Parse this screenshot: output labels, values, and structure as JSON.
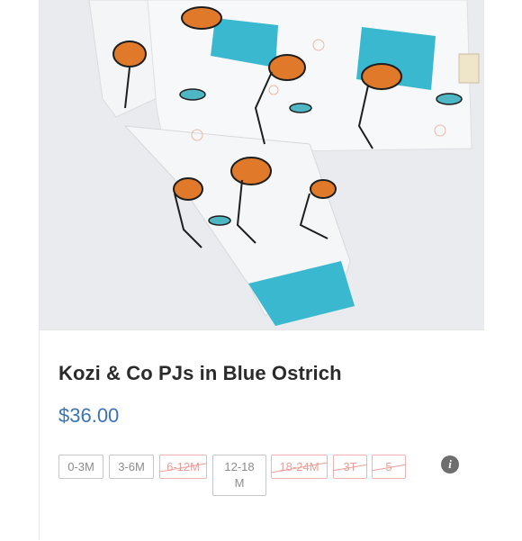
{
  "product": {
    "image_alt": "Kozi & Co PJs in Blue Ostrich photo",
    "title": "Kozi & Co PJs in Blue Ostrich",
    "price": "$36.00"
  },
  "sizes": [
    {
      "label": "0-3M",
      "available": true
    },
    {
      "label": "3-6M",
      "available": true
    },
    {
      "label": "6-12M",
      "available": false
    },
    {
      "label": "12-18M",
      "available": true
    },
    {
      "label": "18-24M",
      "available": false
    },
    {
      "label": "3T",
      "available": false
    },
    {
      "label": "5",
      "available": false
    }
  ],
  "colors": {
    "price": "#3a74b5",
    "cuff": "#3ab8d0",
    "unavailable": "#e8a09a"
  },
  "icons": {
    "size_info": "info-icon"
  }
}
